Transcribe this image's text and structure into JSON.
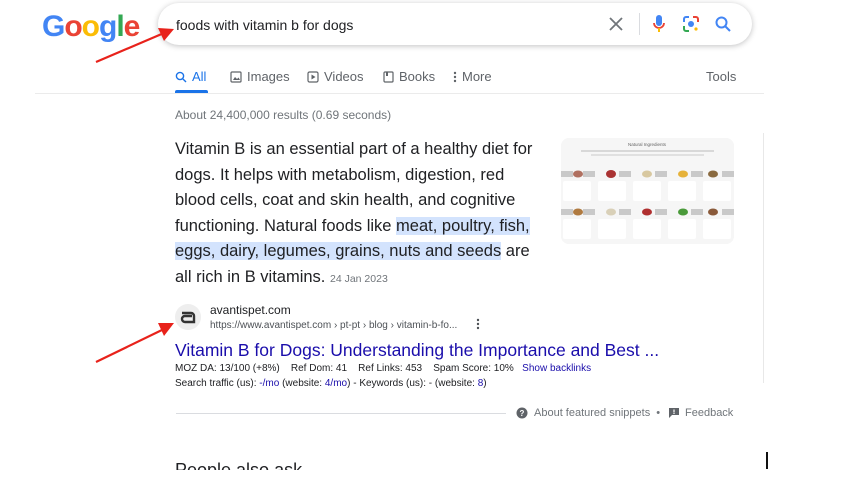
{
  "logo": {
    "text": "Google",
    "letters": [
      "G",
      "o",
      "o",
      "g",
      "l",
      "e"
    ],
    "colors": [
      "#4285f4",
      "#ea4335",
      "#fbbc05",
      "#4285f4",
      "#34a853",
      "#ea4335"
    ]
  },
  "search": {
    "value": "foods with vitamin b for dogs",
    "clear_icon": "close-icon",
    "mic_icon": "microphone-icon",
    "lens_icon": "google-lens-icon",
    "search_icon": "search-icon"
  },
  "tabs": [
    {
      "label": "All",
      "icon": "search-icon",
      "active": true
    },
    {
      "label": "Images",
      "icon": "image-icon"
    },
    {
      "label": "Videos",
      "icon": "video-icon"
    },
    {
      "label": "Books",
      "icon": "book-icon"
    },
    {
      "label": "More",
      "icon": "kebab-icon"
    }
  ],
  "tools_label": "Tools",
  "result_stats": "About 24,400,000 results (0.69 seconds)",
  "snippet": {
    "text_plain": "Vitamin B is an essential part of a healthy diet for dogs. It helps with metabolism, digestion, red blood cells, coat and skin health, and cognitive functioning. Natural foods like ",
    "text_highlight1": "meat, poultry, fish, eggs, dairy, legumes, grains, nuts and seeds",
    "text_after": " are all rich in B vitamins.",
    "date": "24 Jan 2023",
    "image_title": "Natural Ingredients"
  },
  "result": {
    "site_name": "avantispet.com",
    "url": "https://www.avantispet.com › pt-pt › blog › vitamin-b-fo...",
    "title": "Vitamin B for Dogs: Understanding the Importance and Best ...",
    "seo_line1": {
      "moz": "MOZ DA: 13/100 (+8%)",
      "ref_dom": "Ref Dom: 41",
      "ref_links": "Ref Links: 453",
      "spam": "Spam Score: 10%",
      "backlinks_link": "Show backlinks"
    },
    "seo_line2": {
      "prefix": "Search traffic (us): ",
      "traffic": "-/mo",
      "mid1": " (website: ",
      "website_traffic": "4/mo",
      "mid2": ") - Keywords (us): - (website: ",
      "website_keywords": "8",
      "suffix": ")"
    }
  },
  "footer": {
    "about": "About featured snippets",
    "separator": "•",
    "feedback": "Feedback"
  },
  "next_heading": "People also ask",
  "colors": {
    "link": "#1a0dab",
    "accent": "#1a73e8",
    "highlight": "#d3e3fd",
    "arrow": "#e8221b"
  }
}
